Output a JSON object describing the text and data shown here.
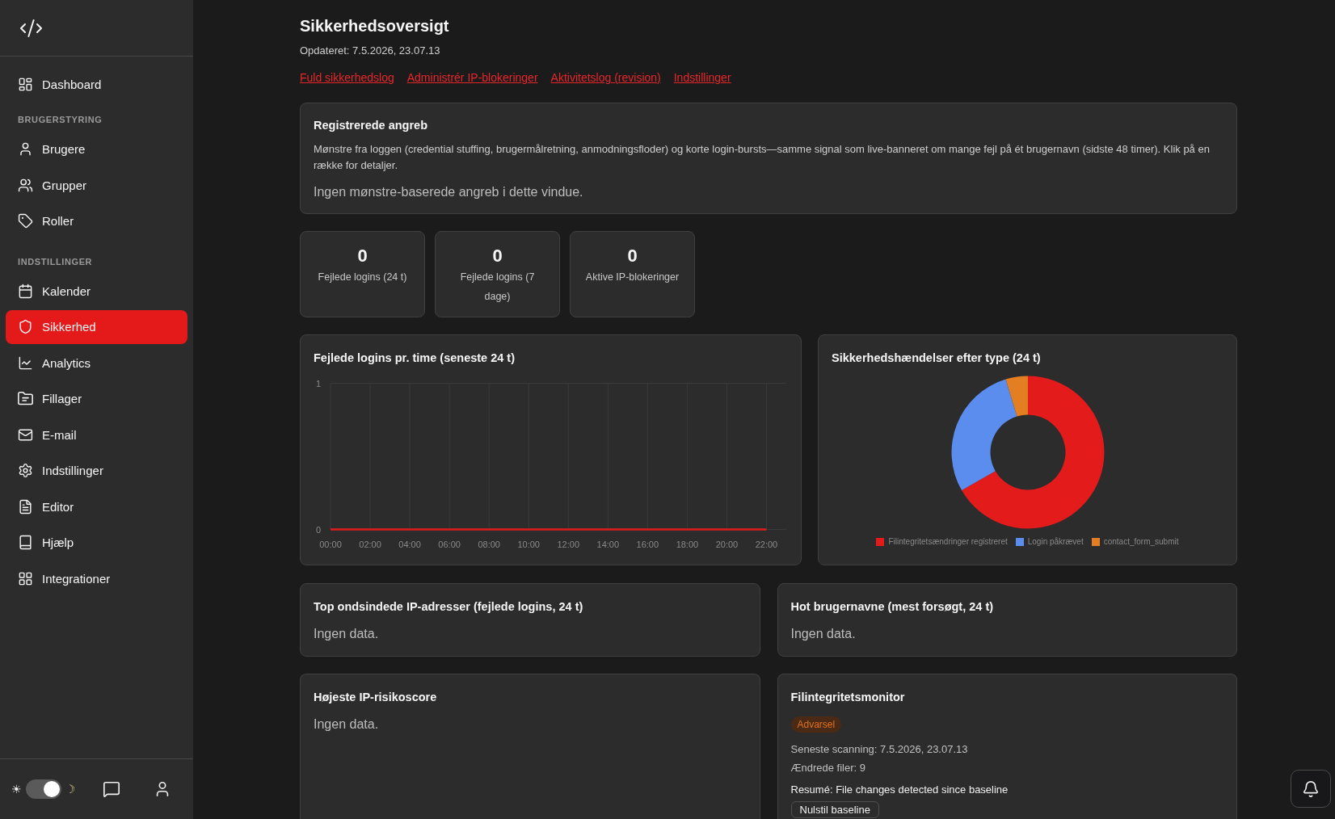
{
  "sidebar": {
    "groups": [
      {
        "items": [
          {
            "label": "Dashboard",
            "selected": false
          }
        ]
      },
      {
        "heading": "BRUGERSTYRING",
        "items": [
          {
            "label": "Brugere",
            "selected": false
          },
          {
            "label": "Grupper",
            "selected": false
          },
          {
            "label": "Roller",
            "selected": false
          }
        ]
      },
      {
        "heading": "INDSTILLINGER",
        "items": [
          {
            "label": "Kalender",
            "selected": false
          },
          {
            "label": "Sikkerhed",
            "selected": true
          },
          {
            "label": "Analytics",
            "selected": false
          },
          {
            "label": "Fillager",
            "selected": false
          },
          {
            "label": "E-mail",
            "selected": false
          },
          {
            "label": "Indstillinger",
            "selected": false
          },
          {
            "label": "Editor",
            "selected": false
          },
          {
            "label": "Hjælp",
            "selected": false
          },
          {
            "label": "Integrationer",
            "selected": false
          }
        ]
      }
    ],
    "theme_toggle": {
      "light_symbol": "☀",
      "dark_symbol": "☽",
      "on": true
    }
  },
  "page": {
    "title": "Sikkerhedsoversigt",
    "updated": "Opdateret: 7.5.2026, 23.07.13",
    "links": [
      "Fuld sikkerhedslog",
      "Administrér IP-blokeringer",
      "Aktivitetslog (revision)",
      "Indstillinger"
    ]
  },
  "attacks_card": {
    "title": "Registrerede angreb",
    "description": "Mønstre fra loggen (credential stuffing, brugermålretning, anmodningsfloder) og korte login-bursts—samme signal som live-banneret om mange fejl på ét brugernavn (sidste 48 timer). Klik på en række for detaljer.",
    "empty_text": "Ingen mønstre-baserede angreb i dette vindue."
  },
  "stats": [
    {
      "value": "0",
      "label": "Fejlede logins (24 t)"
    },
    {
      "value": "0",
      "label": "Fejlede logins (7 dage)"
    },
    {
      "value": "0",
      "label": "Aktive IP-blokeringer"
    }
  ],
  "failed_logins_chart": {
    "chart_data": {
      "type": "line",
      "title": "Fejlede logins pr. time (seneste 24 t)",
      "categories": [
        "00:00",
        "02:00",
        "04:00",
        "06:00",
        "08:00",
        "10:00",
        "12:00",
        "14:00",
        "16:00",
        "18:00",
        "20:00",
        "22:00"
      ],
      "values": [
        0,
        0,
        0,
        0,
        0,
        0,
        0,
        0,
        0,
        0,
        0,
        0
      ],
      "ylim": [
        0,
        1
      ],
      "yticks": [
        {
          "value": 0,
          "label": "0"
        },
        {
          "value": 1,
          "label": "1"
        }
      ],
      "grid": true
    }
  },
  "events_chart": {
    "chart_data": {
      "type": "donut",
      "title": "Sikkerhedshændelser efter type (24 t)",
      "categories": [
        "Filintegritetsændringer registreret",
        "Login påkrævet",
        "contact_form_submit"
      ],
      "values": [
        66.7,
        28.6,
        4.7
      ],
      "colors": [
        "#e31b1b",
        "#5b8dee",
        "#e37e22"
      ],
      "legend": "bottom"
    }
  },
  "panels": [
    {
      "title": "Top ondsindede IP-adresser (fejlede logins, 24 t)",
      "empty_text": "Ingen data."
    },
    {
      "title": "Hot brugernavne (mest forsøgt, 24 t)",
      "empty_text": "Ingen data."
    },
    {
      "title": "Højeste IP-risikoscore",
      "empty_text": "Ingen data."
    }
  ],
  "file_integrity": {
    "title": "Filintegritetsmonitor",
    "badge": "Advarsel",
    "last_scan": "Seneste scanning: 7.5.2026, 23.07.13",
    "changed_files": "Ændrede filer: 9",
    "summary": "Resumé: File changes detected since baseline",
    "button": "Nulstil baseline"
  }
}
